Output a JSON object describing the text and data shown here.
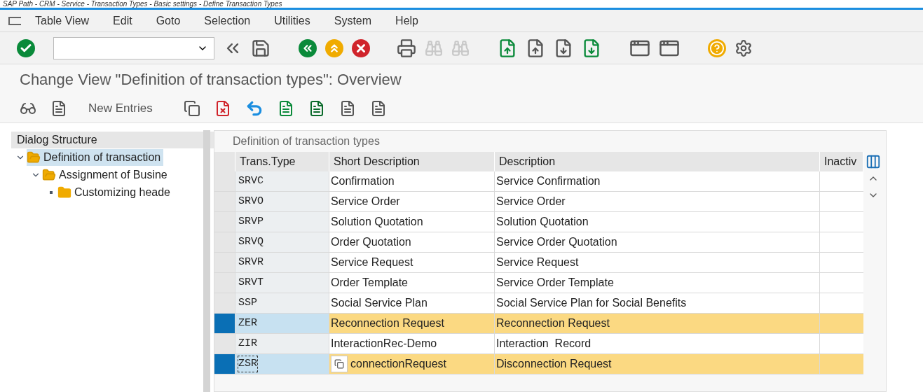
{
  "caption": "SAP Path - CRM - Service - Transaction Types - Basic settings - Define Transaction Types",
  "menu": [
    {
      "label": "Table View"
    },
    {
      "label": "Edit"
    },
    {
      "label": "Goto"
    },
    {
      "label": "Selection"
    },
    {
      "label": "Utilities"
    },
    {
      "label": "System"
    },
    {
      "label": "Help"
    }
  ],
  "title": "Change View \"Definition of transaction types\": Overview",
  "app_toolbar": {
    "new_entries": "New Entries"
  },
  "dialog_structure": {
    "title": "Dialog Structure",
    "items": [
      {
        "label": "Definition of transaction",
        "selected": true,
        "expanded": true,
        "children": [
          {
            "label": "Assignment of Busine",
            "selected": false,
            "expanded": true,
            "children": [
              {
                "label": "Customizing heade",
                "selected": false
              }
            ]
          }
        ]
      }
    ]
  },
  "table": {
    "title": "Definition of transaction types",
    "columns": [
      "Trans.Type",
      "Short Description",
      "Description",
      "Inactiv"
    ],
    "rows": [
      {
        "cells": [
          "SRVC",
          "Confirmation",
          "Service Confirmation"
        ],
        "selected": false,
        "focused": false
      },
      {
        "cells": [
          "SRVO",
          "Service Order",
          "Service Order"
        ],
        "selected": false,
        "focused": false
      },
      {
        "cells": [
          "SRVP",
          "Solution Quotation",
          "Solution Quotation"
        ],
        "selected": false,
        "focused": false
      },
      {
        "cells": [
          "SRVQ",
          "Order Quotation",
          "Service Order Quotation"
        ],
        "selected": false,
        "focused": false
      },
      {
        "cells": [
          "SRVR",
          "Service Request",
          "Service Request"
        ],
        "selected": false,
        "focused": false
      },
      {
        "cells": [
          "SRVT",
          "Order Template",
          "Service Order Template"
        ],
        "selected": false,
        "focused": false
      },
      {
        "cells": [
          "SSP",
          "Social Service Plan",
          "Social Service Plan for Social Benefits"
        ],
        "selected": false,
        "focused": false
      },
      {
        "cells": [
          "ZER",
          "Reconnection Request",
          "Reconnection Request"
        ],
        "selected": true,
        "focused": false
      },
      {
        "cells": [
          "ZIR",
          "InteractionRec-Demo",
          "Interaction  Record"
        ],
        "selected": false,
        "focused": false
      },
      {
        "cells": [
          "ZSR",
          "connectionRequest",
          "Disconnection Request"
        ],
        "selected": true,
        "focused": true
      }
    ]
  }
}
